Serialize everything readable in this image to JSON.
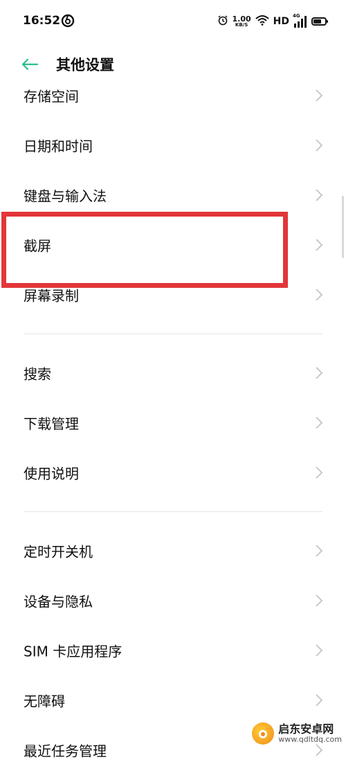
{
  "status_bar": {
    "time": "16:52",
    "net_speed_value": "1.00",
    "net_speed_unit": "KB/S",
    "hd": "HD",
    "signal_label": "4G",
    "app_icon": "netease-music-icon",
    "alarm_icon": "alarm-clock-icon",
    "wifi_icon": "wifi-icon",
    "battery_icon": "battery-icon",
    "battery_level": 0.6
  },
  "header": {
    "back_icon": "arrow-left-icon",
    "title": "其他设置",
    "accent_color": "#2dbf8b"
  },
  "groups": [
    {
      "items": [
        {
          "label": "存储空间"
        },
        {
          "label": "日期和时间"
        },
        {
          "label": "键盘与输入法"
        },
        {
          "label": "截屏"
        },
        {
          "label": "屏幕录制"
        }
      ]
    },
    {
      "items": [
        {
          "label": "搜索"
        },
        {
          "label": "下载管理"
        },
        {
          "label": "使用说明"
        }
      ]
    },
    {
      "items": [
        {
          "label": "定时开关机"
        },
        {
          "label": "设备与隐私"
        },
        {
          "label": "SIM 卡应用程序"
        },
        {
          "label": "无障碍"
        },
        {
          "label": "最近任务管理"
        }
      ]
    }
  ],
  "highlight_color": "#e2363a",
  "watermark": {
    "name": "启东安卓网",
    "url": "www.qdltdq.com"
  }
}
